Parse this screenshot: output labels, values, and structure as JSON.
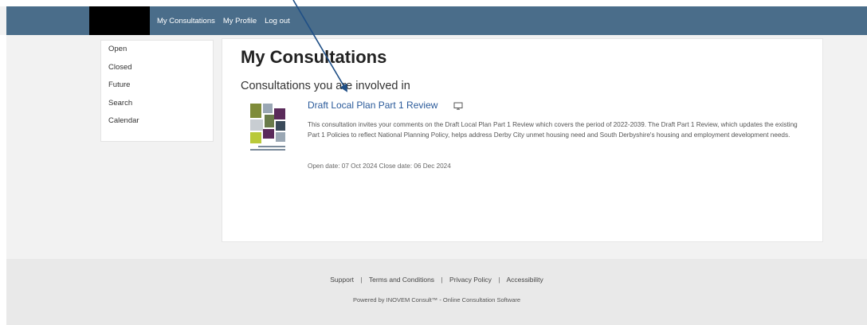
{
  "nav": {
    "links": [
      "My Consultations",
      "My Profile",
      "Log out"
    ]
  },
  "sidebar": {
    "items": [
      "Open",
      "Closed",
      "Future",
      "Search",
      "Calendar"
    ]
  },
  "main": {
    "title": "My Consultations",
    "section_heading": "Consultations you are involved in",
    "consultation": {
      "title": "Draft Local Plan Part 1 Review",
      "description": "This consultation invites your comments on the Draft Local Plan Part 1 Review which covers the period of 2022-2039. The Draft Part 1 Review, which updates the existing Part 1 Policies to reflect National Planning Policy, helps address Derby City unmet housing need and South Derbyshire's housing and employment development needs.",
      "dates": "Open date: 07 Oct 2024 Close date: 06 Dec 2024",
      "icon": "monitor-icon",
      "thumbnail_colors": [
        "#7f8c3a",
        "#5a2a5a",
        "#9aa7b4",
        "#b9c93a"
      ]
    }
  },
  "footer": {
    "links": [
      "Support",
      "Terms and Conditions",
      "Privacy Policy",
      "Accessibility"
    ],
    "separator": "|",
    "powered_by": "Powered by INOVEM Consult™ - Online Consultation Software"
  },
  "colors": {
    "navbar": "#4a6d8a",
    "link": "#2a5a9a",
    "annotation_arrow": "#1f4f86"
  }
}
